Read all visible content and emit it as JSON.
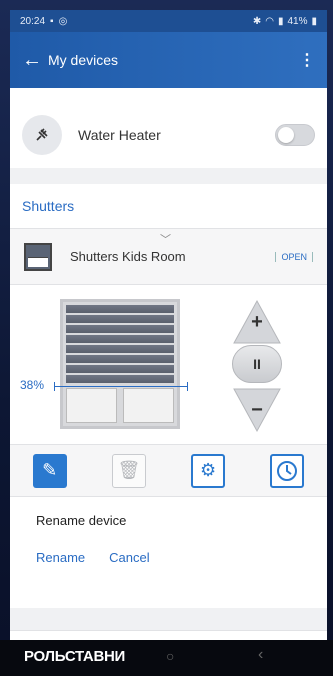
{
  "status_bar": {
    "time": "20:24",
    "left_icons": [
      "gallery-icon",
      "sync-icon"
    ],
    "right_icons": [
      "bluetooth-icon",
      "wifi-icon",
      "signal-icon"
    ],
    "battery": "41%"
  },
  "app_bar": {
    "back_label": "←",
    "title": "My devices",
    "menu_label": "⋮"
  },
  "devices": [
    {
      "name": "Water Heater",
      "icon": "plug-icon",
      "state": "off"
    }
  ],
  "shutters_section": {
    "title": "Shutters",
    "device": {
      "name": "Shutters Kids Room",
      "open_label": "OPEN",
      "position_label": "38%",
      "position_percent": 38
    },
    "controls": {
      "up": "+",
      "pause": "II",
      "down": "−"
    },
    "actions": [
      "edit",
      "delete",
      "settings",
      "timer"
    ],
    "rename": {
      "title": "Rename device",
      "rename_label": "Rename",
      "cancel_label": "Cancel"
    }
  },
  "caption": "РОЛЬСТАВНИ",
  "nav": {
    "home": "○",
    "back": "‹"
  },
  "colors": {
    "accent": "#2a6cc3",
    "app_bar": "#1f5aa8"
  }
}
